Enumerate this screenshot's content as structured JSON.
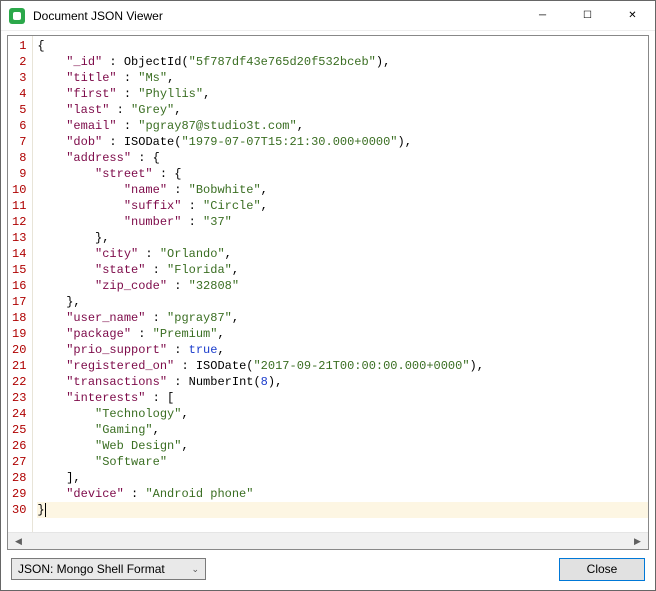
{
  "window": {
    "title": "Document JSON Viewer",
    "minimize": "─",
    "maximize": "☐",
    "close": "✕"
  },
  "footer": {
    "format_label": "JSON: Mongo Shell Format",
    "close_label": "Close"
  },
  "scroll": {
    "left": "◀",
    "right": "▶"
  },
  "doc": {
    "_id": "5f787df43e765d20f532bceb",
    "title": "Ms",
    "first": "Phyllis",
    "last": "Grey",
    "email": "pgray87@studio3t.com",
    "dob": "1979-07-07T15:21:30.000+0000",
    "address": {
      "street": {
        "name": "Bobwhite",
        "suffix": "Circle",
        "number": "37"
      },
      "city": "Orlando",
      "state": "Florida",
      "zip_code": "32808"
    },
    "user_name": "pgray87",
    "package": "Premium",
    "prio_support": "true",
    "registered_on": "2017-09-21T00:00:00.000+0000",
    "transactions": "8",
    "interests": [
      "Technology",
      "Gaming",
      "Web Design",
      "Software"
    ],
    "device": "Android phone"
  },
  "keys": {
    "_id": "\"_id\"",
    "title": "\"title\"",
    "first": "\"first\"",
    "last": "\"last\"",
    "email": "\"email\"",
    "dob": "\"dob\"",
    "address": "\"address\"",
    "street": "\"street\"",
    "name": "\"name\"",
    "suffix": "\"suffix\"",
    "number": "\"number\"",
    "city": "\"city\"",
    "state": "\"state\"",
    "zip_code": "\"zip_code\"",
    "user_name": "\"user_name\"",
    "package": "\"package\"",
    "prio_support": "\"prio_support\"",
    "registered_on": "\"registered_on\"",
    "transactions": "\"transactions\"",
    "interests": "\"interests\"",
    "device": "\"device\""
  },
  "fns": {
    "objectid": "ObjectId",
    "isodate": "ISODate",
    "numberint": "NumberInt"
  },
  "line_count": 30
}
